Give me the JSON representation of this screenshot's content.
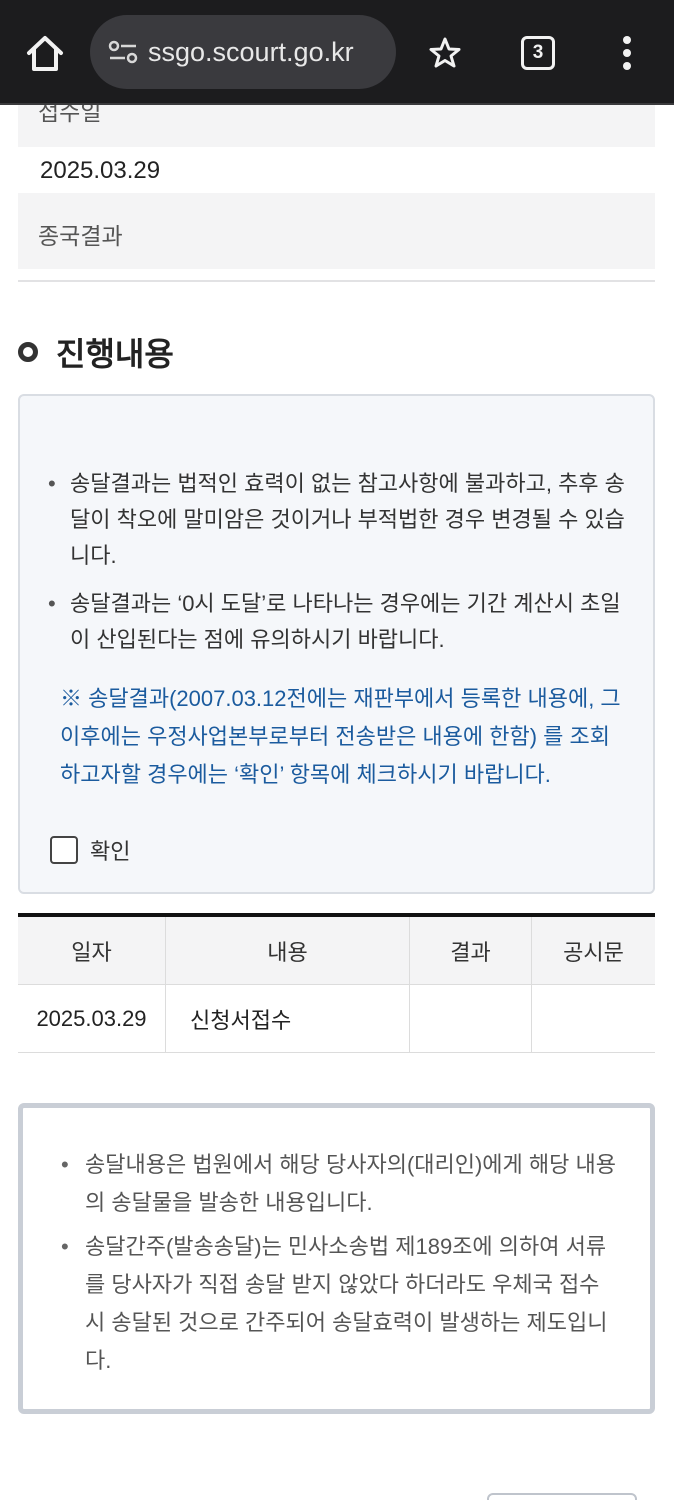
{
  "browser": {
    "url": "ssgo.scourt.go.kr",
    "tab_count": "3"
  },
  "info_rows": [
    {
      "label": "접수일"
    },
    {
      "value": "2025.03.29"
    },
    {
      "label": "종국결과"
    }
  ],
  "section": {
    "title": "진행내용"
  },
  "notice": {
    "items": [
      "송달결과는 법적인 효력이 없는 참고사항에 불과하고, 추후 송달이 착오에 말미암은 것이거나 부적법한 경우 변경될 수 있습니다.",
      "송달결과는 ‘0시 도달’로 나타나는 경우에는 기간 계산시 초일이 산입된다는 점에 유의하시기 바랍니다."
    ],
    "note": "※ 송달결과(2007.03.12전에는 재판부에서 등록한 내용에, 그 이후에는 우정사업본부로부터 전송받은 내용에 한함) 를 조회하고자할 경우에는 ‘확인’ 항목에 체크하시기 바랍니다.",
    "confirm_label": "확인"
  },
  "table": {
    "headers": [
      "일자",
      "내용",
      "결과",
      "공시문"
    ],
    "rows": [
      [
        "2025.03.29",
        "신청서접수",
        "",
        ""
      ]
    ]
  },
  "info_box": {
    "items": [
      "송달내용은 법원에서 해당 당사자의(대리인)에게 해당 내용의 송달물을 발송한 내용입니다.",
      "송달간주(발송송달)는 민사소송법 제189조에 의하여 서류를 당사자가 직접 송달 받지 않았다 하더라도 우체국 접수 시 송달된 것으로 간주되어 송달효력이 발생하는 제도입니다."
    ]
  },
  "colors": {
    "browser_bar": "#1c1c1e",
    "note_blue": "#1b5b9e",
    "row_gray": "#f4f4f5"
  },
  "icons": [
    "home-icon",
    "site-settings-icon",
    "star-icon",
    "tab-switcher-icon",
    "more-menu-icon",
    "circle-bullet-icon"
  ]
}
